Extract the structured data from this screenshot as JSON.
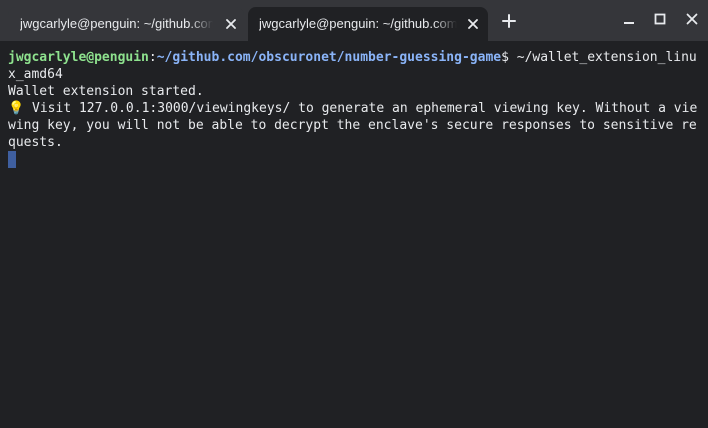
{
  "tabs": [
    {
      "title": "jwgcarlyle@penguin: ~/github.com/obscuronet/number-guessing-game",
      "active": false
    },
    {
      "title": "jwgcarlyle@penguin: ~/github.com/obscuronet/number-guessing-game",
      "active": true
    }
  ],
  "icons": {
    "tab_close": "close-icon",
    "new_tab": "plus-icon",
    "minimize": "minimize-icon",
    "maximize": "maximize-icon",
    "window_close": "close-icon"
  },
  "terminal": {
    "prompt_user_host": "jwgcarlyle@penguin",
    "prompt_sep": ":",
    "prompt_path": "~/github.com/obscuronet/number-guessing-game",
    "prompt_symbol": "$ ",
    "command_line_1": "~/wallet_extension_linu",
    "command_line_2": "x_amd64",
    "output": [
      "Wallet extension started.",
      "💡 Visit 127.0.0.1:3000/viewingkeys/ to generate an ephemeral viewing key. Without a vie",
      "wing key, you will not be able to decrypt the enclave's secure responses to sensitive re",
      "quests."
    ]
  },
  "colors": {
    "background": "#202124",
    "titlebar": "#35363a",
    "prompt_user": "#8ee28e",
    "prompt_path": "#8ab4f8",
    "cursor": "#3f5f9f"
  }
}
